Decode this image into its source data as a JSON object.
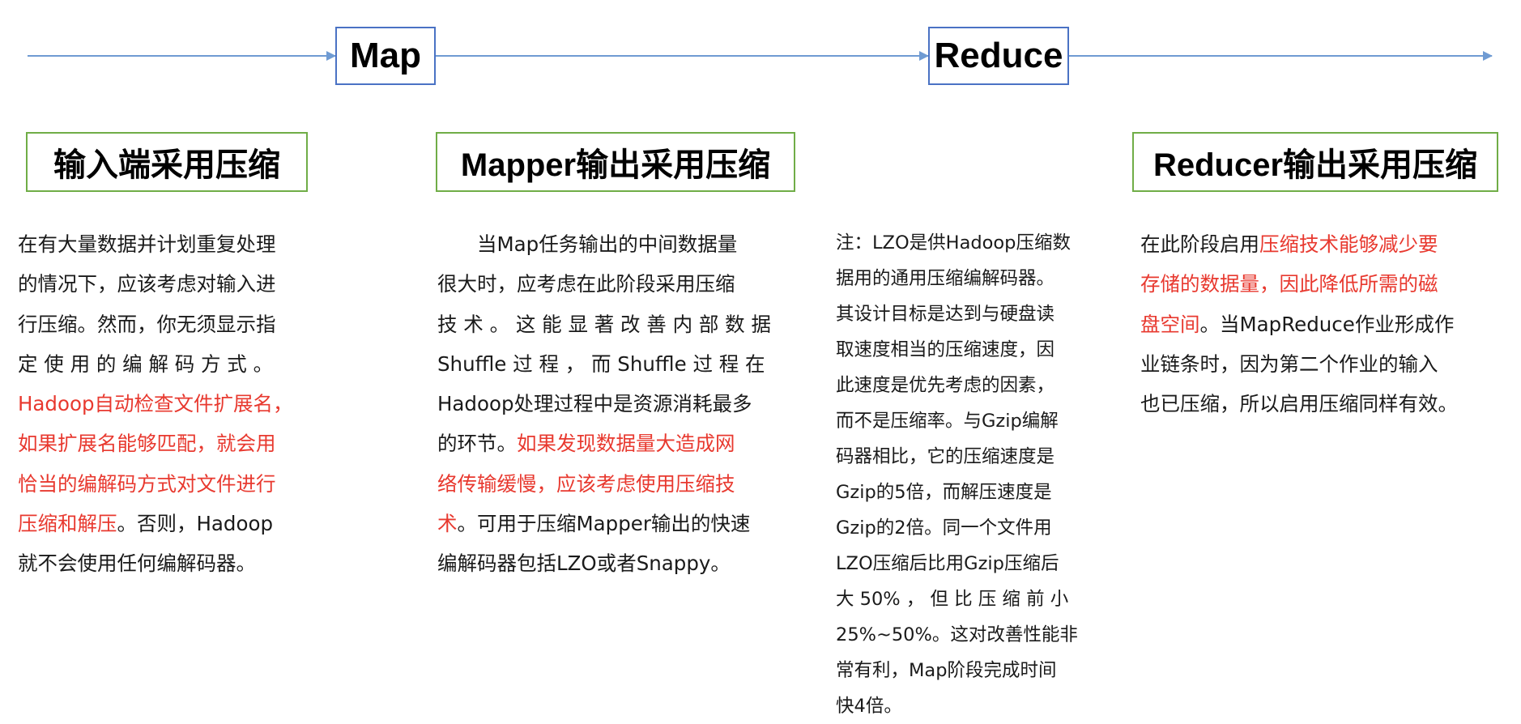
{
  "flow": {
    "map_label": "Map",
    "reduce_label": "Reduce",
    "arrow_color": "#6f9bd3",
    "box_border_color": "#4a72c4"
  },
  "sections": {
    "input": {
      "title": "输入端采用压缩",
      "lines": [
        [
          {
            "text": "在有大量数据并计划重复处理"
          }
        ],
        [
          {
            "text": "的情况下，应该考虑对输入进"
          }
        ],
        [
          {
            "text": "行压缩。然而，你无须显示指"
          }
        ],
        [
          {
            "text": "定 使 用 的 编 解 码 方 式 。"
          }
        ],
        [
          {
            "text": "Hadoop自动检查文件扩展名，",
            "red": true
          }
        ],
        [
          {
            "text": "如果扩展名能够匹配，就会用",
            "red": true
          }
        ],
        [
          {
            "text": "恰当的编解码方式对文件进行",
            "red": true
          }
        ],
        [
          {
            "text": "压缩和解压",
            "red": true
          },
          {
            "text": "。否则，Hadoop"
          }
        ],
        [
          {
            "text": "就不会使用任何编解码器。"
          }
        ]
      ]
    },
    "mapper": {
      "title": "Mapper输出采用压缩",
      "lines": [
        [
          {
            "text": "　　当Map任务输出的中间数据量"
          }
        ],
        [
          {
            "text": "很大时，应考虑在此阶段采用压缩"
          }
        ],
        [
          {
            "text": "技 术 。 这 能 显 著 改 善 内 部 数 据"
          }
        ],
        [
          {
            "text": "Shuffle 过 程 ， 而 Shuffle 过 程 在"
          }
        ],
        [
          {
            "text": "Hadoop处理过程中是资源消耗最多"
          }
        ],
        [
          {
            "text": "的环节。"
          },
          {
            "text": "如果发现数据量大造成网",
            "red": true
          }
        ],
        [
          {
            "text": "络传输缓慢，应该考虑使用压缩技",
            "red": true
          }
        ],
        [
          {
            "text": "术",
            "red": true
          },
          {
            "text": "。可用于压缩Mapper输出的快速"
          }
        ],
        [
          {
            "text": "编解码器包括LZO或者Snappy。"
          }
        ]
      ]
    },
    "note": {
      "lines": [
        "注：LZO是供Hadoop压缩数",
        "据用的通用压缩编解码器。",
        "其设计目标是达到与硬盘读",
        "取速度相当的压缩速度，因",
        "此速度是优先考虑的因素，",
        "而不是压缩率。与Gzip编解",
        "码器相比，它的压缩速度是",
        "Gzip的5倍，而解压速度是",
        "Gzip的2倍。同一个文件用",
        "LZO压缩后比用Gzip压缩后",
        "大 50% ， 但 比 压 缩 前 小",
        "25%~50%。这对改善性能非",
        "常有利，Map阶段完成时间",
        "快4倍。"
      ]
    },
    "reducer": {
      "title": "Reducer输出采用压缩",
      "lines": [
        [
          {
            "text": "在此阶段启用"
          },
          {
            "text": "压缩技术能够减少要",
            "red": true
          }
        ],
        [
          {
            "text": "存储的数据量，因此降低所需的磁",
            "red": true
          }
        ],
        [
          {
            "text": "盘空间",
            "red": true
          },
          {
            "text": "。当MapReduce作业形成作"
          }
        ],
        [
          {
            "text": "业链条时，因为第二个作业的输入"
          }
        ],
        [
          {
            "text": "也已压缩，所以启用压缩同样有效。"
          }
        ]
      ]
    }
  },
  "colors": {
    "highlight_red": "#e8392f",
    "title_border_green": "#70ad47",
    "text": "#1a1a1a"
  }
}
